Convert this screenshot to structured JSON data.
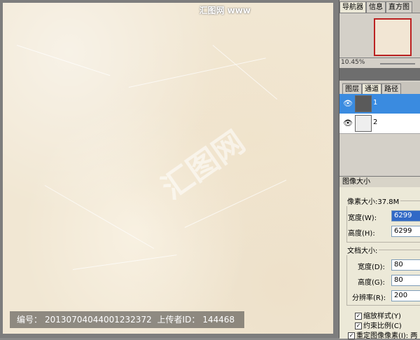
{
  "watermark": {
    "corner_text": "汇图网 www",
    "center_logo": "汇图网"
  },
  "info_bar": {
    "id_label": "编号：",
    "id_value": "20130704044001232372",
    "uploader_label": "上传者ID：",
    "uploader_value": "144468"
  },
  "navigator": {
    "tabs": [
      "导航器",
      "信息",
      "直方图"
    ],
    "zoom": "10.45%"
  },
  "channels_panel": {
    "tabs": [
      "图层",
      "通道",
      "路径"
    ],
    "rows": [
      {
        "name": "1"
      },
      {
        "name": "2"
      }
    ]
  },
  "image_size_dialog": {
    "title": "图像大小",
    "pixel_dimensions_label": "像素大小:37.8M",
    "width_label": "宽度(W):",
    "width_value": "6299",
    "height_label": "高度(H):",
    "height_value": "6299",
    "document_size_label": "文档大小:",
    "doc_width_label": "宽度(D):",
    "doc_width_value": "80",
    "doc_height_label": "高度(G):",
    "doc_height_value": "80",
    "resolution_label": "分辨率(R):",
    "resolution_value": "200",
    "checkboxes": [
      "缩放样式(Y)",
      "约束比例(C)",
      "重定图像像素(I):"
    ],
    "resample_value": "两"
  }
}
